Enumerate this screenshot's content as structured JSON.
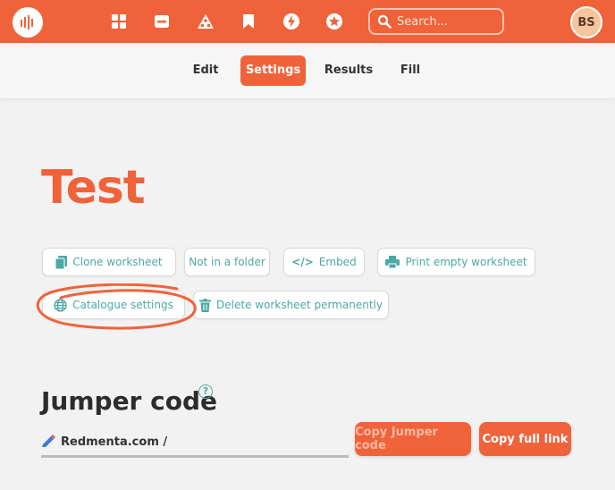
{
  "nav": {
    "logo": "redmenta-logo-icon",
    "icons": [
      "dashboard-grid-icon",
      "card-icon",
      "shapes-icon",
      "bookmark-icon",
      "bolt-icon",
      "star-icon"
    ],
    "search_placeholder": "Search...",
    "avatar_initials": "BS",
    "brand_color": "#f0633a"
  },
  "tabs": [
    {
      "label": "Edit",
      "active": false
    },
    {
      "label": "Settings",
      "active": true
    },
    {
      "label": "Results",
      "active": false
    },
    {
      "label": "Fill",
      "active": false
    }
  ],
  "page": {
    "title": "Test"
  },
  "actions": {
    "clone": "Clone worksheet",
    "folder": "Not in a folder",
    "embed": "Embed",
    "print": "Print empty worksheet",
    "catalogue": "Catalogue settings",
    "delete": "Delete worksheet permanently"
  },
  "jumper": {
    "heading": "Jumper code",
    "help": "?",
    "prefix": "Redmenta.com /",
    "copy_code": "Copy Jumper code",
    "copy_link": "Copy full link"
  },
  "accent_color": "#4ba9a3"
}
